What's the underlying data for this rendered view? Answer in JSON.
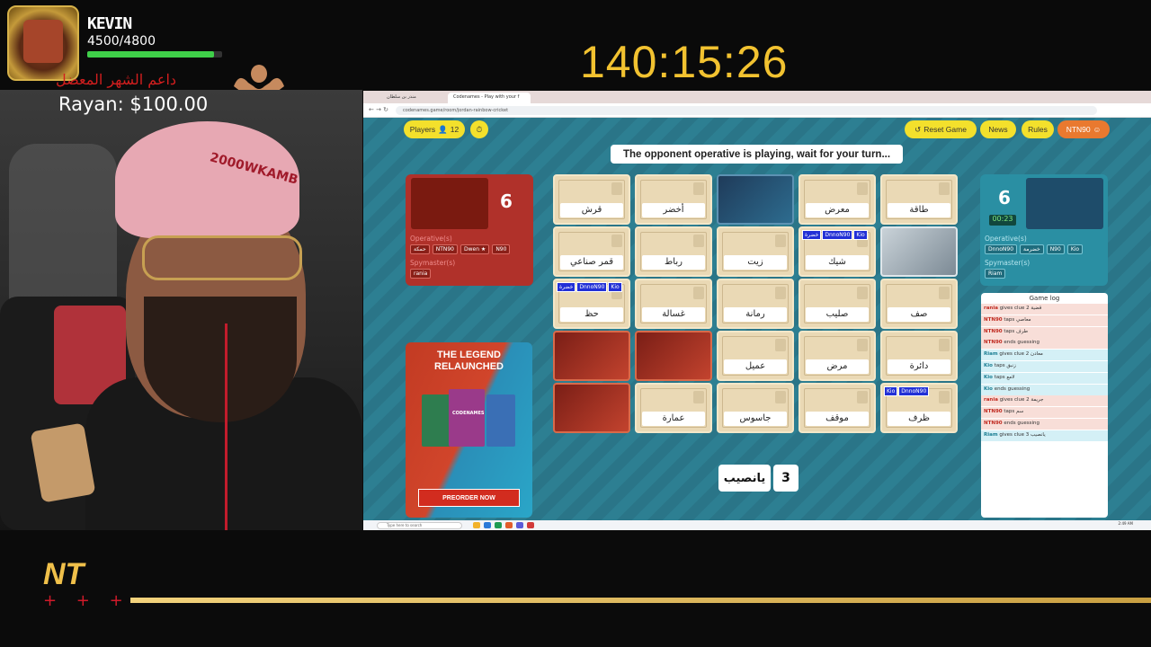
{
  "overlay": {
    "player_name": "KEVIN",
    "hp_text": "4500/4800",
    "hp_fraction": 0.9375,
    "arabic_banner": "داعم الشهر المعضل",
    "donation": "Rayan: $100.00",
    "timer": "140:15:26",
    "beanie_text": "2000WKAMB",
    "logo_text": "NT",
    "logo_plus": "+ + +",
    "colors": {
      "timer": "#f2c230",
      "hp": "#3fcf49",
      "banner": "#d21e1e",
      "gold_bar": "#d4b25a"
    }
  },
  "browser": {
    "tabs": [
      "منذر بن سلطان",
      "Codenames - Play with your f"
    ],
    "url": "codenames.game/room/jordan-rainbow-cricket"
  },
  "toolbar": {
    "players_label": "Players",
    "players_count": "12",
    "reset_label": "Reset Game",
    "news_label": "News",
    "rules_label": "Rules",
    "account_label": "NTN90"
  },
  "status": "The opponent operative is playing, wait for your turn...",
  "red_team": {
    "count": "6",
    "operatives_label": "Operative(s)",
    "operatives": [
      "حمكة",
      "NTN90",
      "Dwen ★",
      "N90"
    ],
    "spymaster_label": "Spymaster(s)",
    "spymasters": [
      "rania"
    ]
  },
  "blue_team": {
    "count": "6",
    "timer": "00:23",
    "operatives_label": "Operative(s)",
    "operatives": [
      "DnnoN90",
      "خضرمة",
      "N90",
      "Kio"
    ],
    "spymaster_label": "Spymaster(s)",
    "spymasters": [
      "Riam"
    ]
  },
  "cards": [
    {
      "word": "قرش",
      "state": "hidden",
      "tags": []
    },
    {
      "word": "أخضر",
      "state": "hidden",
      "tags": []
    },
    {
      "word": "",
      "state": "agent-blue",
      "tags": []
    },
    {
      "word": "معرض",
      "state": "hidden",
      "tags": []
    },
    {
      "word": "طاقة",
      "state": "hidden",
      "tags": []
    },
    {
      "word": "قمر صناعي",
      "state": "hidden",
      "tags": []
    },
    {
      "word": "رباط",
      "state": "hidden",
      "tags": []
    },
    {
      "word": "زيت",
      "state": "hidden",
      "tags": []
    },
    {
      "word": "شيك",
      "state": "hidden",
      "tags": [
        "خضرة",
        "DnnoN90",
        "Kio"
      ]
    },
    {
      "word": "",
      "state": "agent-neutral",
      "tags": []
    },
    {
      "word": "حظ",
      "state": "hidden",
      "tags": [
        "خضرة",
        "DnnoN90",
        "Kio"
      ]
    },
    {
      "word": "غسالة",
      "state": "hidden",
      "tags": []
    },
    {
      "word": "رمانة",
      "state": "hidden",
      "tags": []
    },
    {
      "word": "صليب",
      "state": "hidden",
      "tags": []
    },
    {
      "word": "صف",
      "state": "hidden",
      "tags": []
    },
    {
      "word": "",
      "state": "agent-red",
      "tags": []
    },
    {
      "word": "",
      "state": "agent-red",
      "tags": []
    },
    {
      "word": "عميل",
      "state": "hidden",
      "tags": []
    },
    {
      "word": "مرض",
      "state": "hidden",
      "tags": []
    },
    {
      "word": "دائرة",
      "state": "hidden",
      "tags": []
    },
    {
      "word": "",
      "state": "agent-red",
      "tags": []
    },
    {
      "word": "عمارة",
      "state": "hidden",
      "tags": []
    },
    {
      "word": "جاسوس",
      "state": "hidden",
      "tags": []
    },
    {
      "word": "موقف",
      "state": "hidden",
      "tags": []
    },
    {
      "word": "ظرف",
      "state": "hidden",
      "tags": [
        "Kio",
        "DnnoN90"
      ]
    }
  ],
  "clue": {
    "word": "يانصيب",
    "number": "3"
  },
  "ad": {
    "headline": "THE LEGEND RELAUNCHED",
    "product": "CODENAMES",
    "cta": "PREORDER NOW"
  },
  "game_log": {
    "title": "Game log",
    "entries": [
      {
        "team": "red",
        "who": "rania",
        "text": "gives clue",
        "extra": "قضية 2"
      },
      {
        "team": "red",
        "who": "NTN90",
        "text": "taps",
        "extra": "معاصي"
      },
      {
        "team": "red",
        "who": "NTN90",
        "text": "taps",
        "extra": "طرف"
      },
      {
        "team": "red",
        "who": "NTN90",
        "text": "ends guessing",
        "extra": ""
      },
      {
        "team": "blue",
        "who": "Riam",
        "text": "gives clue",
        "extra": "معادن 2"
      },
      {
        "team": "blue",
        "who": "Kio",
        "text": "taps",
        "extra": "زنبق"
      },
      {
        "team": "blue",
        "who": "Kio",
        "text": "taps",
        "extra": "لامع"
      },
      {
        "team": "blue",
        "who": "Kio",
        "text": "ends guessing",
        "extra": ""
      },
      {
        "team": "red",
        "who": "rania",
        "text": "gives clue",
        "extra": "جريمة 2"
      },
      {
        "team": "red",
        "who": "NTN90",
        "text": "taps",
        "extra": "سم"
      },
      {
        "team": "red",
        "who": "NTN90",
        "text": "ends guessing",
        "extra": ""
      },
      {
        "team": "blue",
        "who": "Riam",
        "text": "gives clue",
        "extra": "يانصيب 3"
      }
    ]
  },
  "taskbar": {
    "search_placeholder": "Type here to search",
    "clock": "2:49 AM"
  }
}
